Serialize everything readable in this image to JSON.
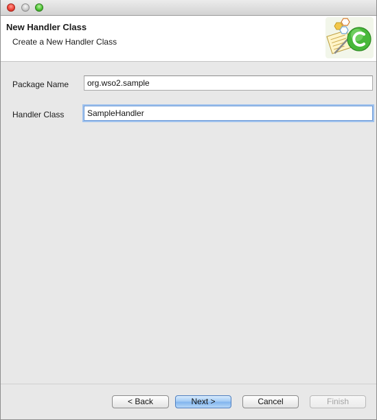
{
  "banner": {
    "title": "New Handler Class",
    "subtitle": "Create a New Handler Class",
    "graphic_icon": "wso2-class-wizard-icon"
  },
  "form": {
    "package_label": "Package Name",
    "package_value": "org.wso2.sample",
    "class_label": "Handler Class",
    "class_value": "SampleHandler"
  },
  "buttons": {
    "back": "< Back",
    "next": "Next >",
    "cancel": "Cancel",
    "finish": "Finish"
  },
  "colors": {
    "default_button": "#7fb3ee",
    "focus_ring": "#9fc2ee",
    "close_light": "#f0453a",
    "zoom_light": "#4fc436"
  }
}
